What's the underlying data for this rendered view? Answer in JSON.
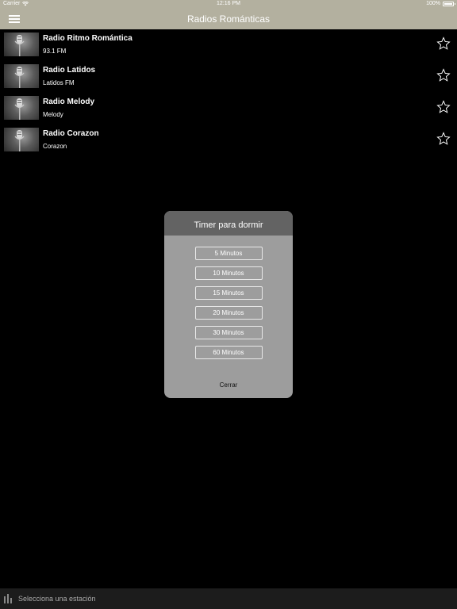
{
  "status": {
    "carrier": "Carrier",
    "time": "12:16 PM",
    "battery": "100%"
  },
  "nav": {
    "title": "Radios Románticas",
    "menu_icon": "hamburger-icon"
  },
  "stations": [
    {
      "name": "Radio Ritmo Romántica",
      "subtitle": "93.1 FM"
    },
    {
      "name": "Radio Latidos",
      "subtitle": "Latidos FM"
    },
    {
      "name": "Radio Melody",
      "subtitle": "Melody"
    },
    {
      "name": "Radio Corazon",
      "subtitle": "Corazon"
    }
  ],
  "modal": {
    "title": "Timer para dormir",
    "options": [
      "5 Minutos",
      "10 Minutos",
      "15 Minutos",
      "20 Minutos",
      "30 Minutos",
      "60 Minutos"
    ],
    "close_label": "Cerrar"
  },
  "player": {
    "status_text": "Selecciona una estación",
    "icon": "equalizer-icon"
  },
  "colors": {
    "nav_bar": "#b3b09f",
    "background": "#000000",
    "modal_body": "#9d9d9d",
    "modal_header": "#636363",
    "player_bar": "#1c1c1c"
  }
}
